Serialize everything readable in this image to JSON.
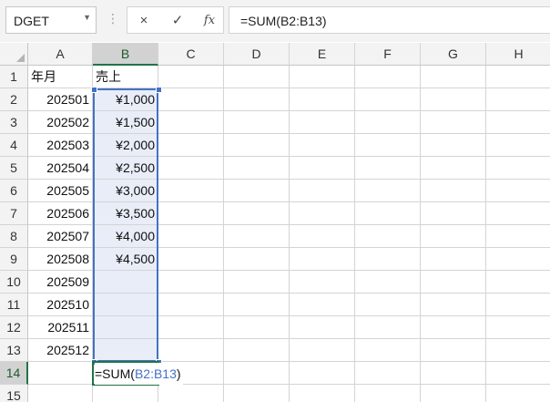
{
  "formula_bar": {
    "name_box": "DGET",
    "cancel_icon": "×",
    "enter_icon": "✓",
    "fx_label": "fx",
    "formula": "=SUM(B2:B13)"
  },
  "columns": [
    "A",
    "B",
    "C",
    "D",
    "E",
    "F",
    "G",
    "H"
  ],
  "rows": [
    "1",
    "2",
    "3",
    "4",
    "5",
    "6",
    "7",
    "8",
    "9",
    "10",
    "11",
    "12",
    "13",
    "14",
    "15"
  ],
  "cells": {
    "A1": "年月",
    "B1": "売上",
    "A2": "202501",
    "B2": "¥1,000",
    "A3": "202502",
    "B3": "¥1,500",
    "A4": "202503",
    "B4": "¥2,000",
    "A5": "202504",
    "B5": "¥2,500",
    "A6": "202505",
    "B6": "¥3,000",
    "A7": "202506",
    "B7": "¥3,500",
    "A8": "202507",
    "B8": "¥4,000",
    "A9": "202508",
    "B9": "¥4,500",
    "A10": "202509",
    "A11": "202510",
    "A12": "202511",
    "A13": "202512"
  },
  "editing": {
    "cell": "B14",
    "prefix": "=SUM(",
    "reference": "B2:B13",
    "suffix": ")"
  },
  "colors": {
    "accent_green": "#217346",
    "range_blue": "#4472c4",
    "range_fill": "#e8edf8"
  }
}
